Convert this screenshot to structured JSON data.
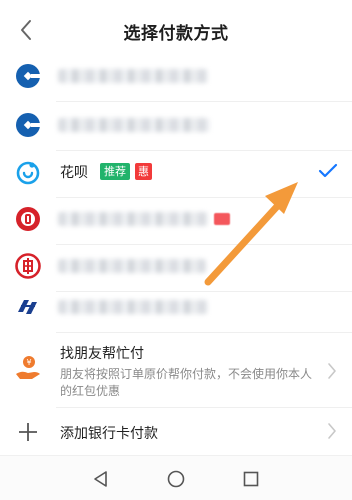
{
  "header": {
    "title": "选择付款方式"
  },
  "methods": {
    "huabei": {
      "name": "花呗",
      "tag_recommend": "推荐",
      "tag_discount": "惠"
    }
  },
  "friend": {
    "title": "找朋友帮忙付",
    "desc": "朋友将按照订单原价帮你付款，不会使用你本人的红包优惠"
  },
  "add_card": {
    "label": "添加银行卡付款"
  },
  "icons": {
    "back": "chevron-left-icon",
    "check": "check-icon",
    "chevron": "chevron-right-icon",
    "nav_back": "triangle-back-icon",
    "nav_home": "circle-home-icon",
    "nav_recent": "square-recent-icon"
  },
  "colors": {
    "accent_blue": "#1677ff",
    "ccb_blue": "#1560b0",
    "huabei_blue": "#1aa1ea",
    "tag_green": "#21b36b",
    "tag_red": "#f23a3a",
    "bank_red": "#d6222a",
    "arrow_orange": "#f39a3a"
  }
}
